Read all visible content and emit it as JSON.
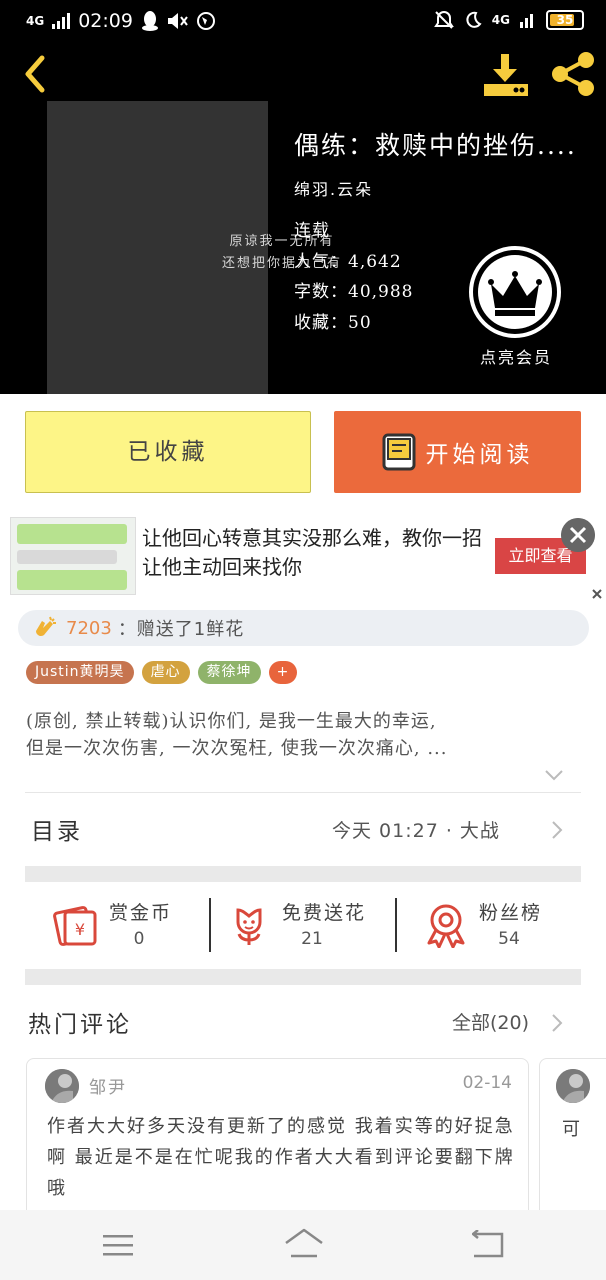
{
  "status_bar": {
    "network": "4G",
    "time": "02:09",
    "network_right": "4G",
    "battery": "35"
  },
  "book": {
    "title": "偶练：救赎中的挫伤....",
    "author": "绵羽.云朵",
    "cover_lines": [
      "原谅我一无所有",
      "还想把你据为己有"
    ],
    "status": "连载",
    "popularity": "人气：4,642",
    "word_count": "字数：40,988",
    "favorites": "收藏：50"
  },
  "vip": {
    "label": "点亮会员"
  },
  "actions": {
    "collected": "已收藏",
    "read": "开始阅读"
  },
  "ad": {
    "text": "让他回心转意其实没那么难，教你一招让他主动回来找你",
    "button": "立即查看"
  },
  "gift": {
    "user": "7203",
    "text": "：赠送了1鲜花"
  },
  "tags": [
    "Justin黄明昊",
    "虐心",
    "蔡徐坤",
    "+"
  ],
  "tag_colors": [
    "#c6744f",
    "#d3a23f",
    "#8fb36a",
    "#e8643c"
  ],
  "description": {
    "line1": "(原创, 禁止转载)认识你们, 是我一生最大的幸运,",
    "line2": "但是一次次伤害, 一次次冤枉, 使我一次次痛心, ..."
  },
  "toc": {
    "title": "目录",
    "latest": "今天 01:27 · 大战"
  },
  "stats": [
    {
      "label": "赏金币",
      "value": "0",
      "icon": "red-envelope-icon"
    },
    {
      "label": "免费送花",
      "value": "21",
      "icon": "flower-icon"
    },
    {
      "label": "粉丝榜",
      "value": "54",
      "icon": "medal-icon"
    }
  ],
  "comments": {
    "title": "热门评论",
    "all_label": "全部(20)",
    "items": [
      {
        "user": "邹尹",
        "date": "02-14",
        "text": "作者大大好多天没有更新了的感觉 我着实等的好捉急啊 最近是不是在忙呢我的作者大大看到评论要翻下牌哦"
      },
      {
        "peek": "可"
      }
    ]
  },
  "colors": {
    "accent_orange": "#eb6a3c",
    "collected_yellow": "#fdf587",
    "icon_red": "#d9483b"
  }
}
